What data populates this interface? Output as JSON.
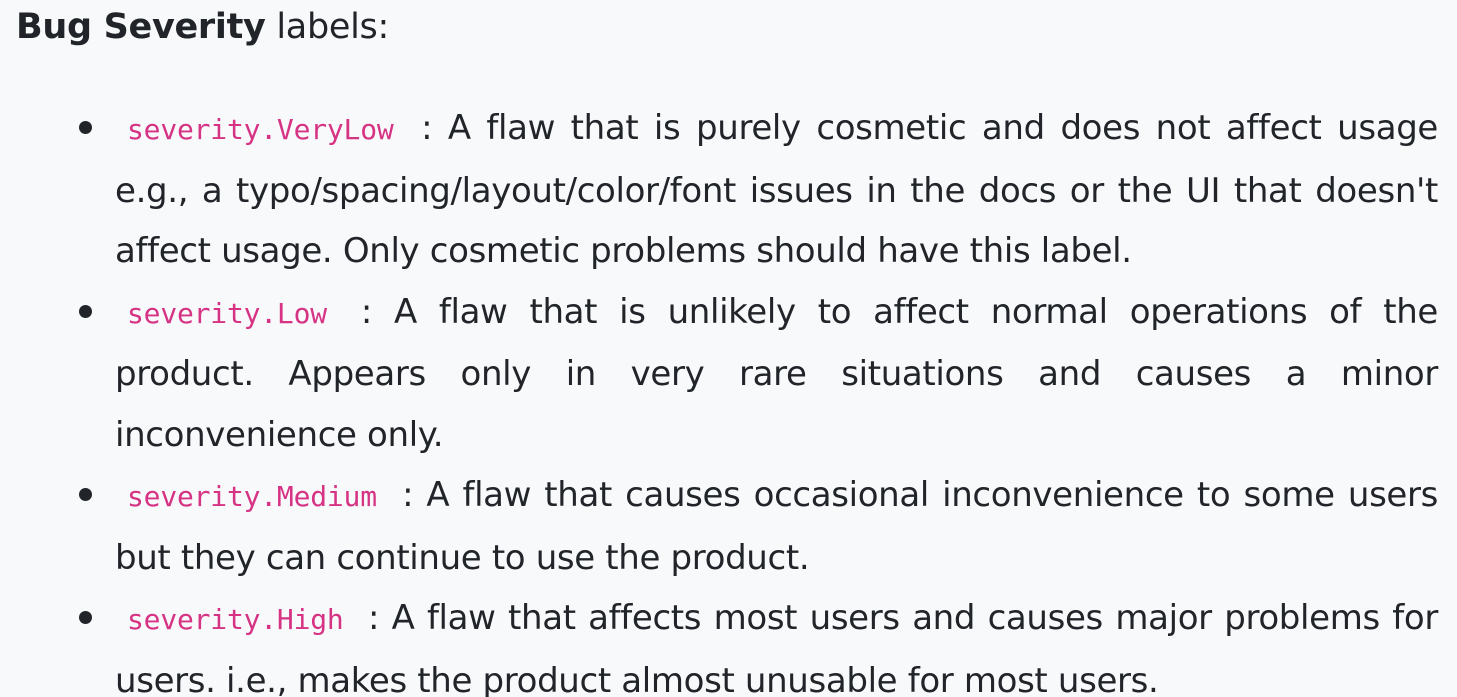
{
  "heading": {
    "bold": "Bug Severity",
    "rest": " labels:"
  },
  "items": [
    {
      "code": "severity.VeryLow",
      "text": ": A flaw that is purely cosmetic and does not affect usage e.g., a typo/spacing/layout/color/font issues in the docs or the UI that doesn't affect usage. Only cosmetic problems should have this label."
    },
    {
      "code": "severity.Low",
      "text": ": A flaw that is unlikely to affect normal operations of the product. Appears only in very rare situations and causes a minor inconvenience only."
    },
    {
      "code": "severity.Medium",
      "text": ": A flaw that causes occasional inconvenience to some users but they can continue to use the product."
    },
    {
      "code": "severity.High",
      "text": ": A flaw that affects most users and causes major problems for users. i.e., makes the product almost unusable for most users."
    }
  ],
  "colors": {
    "background": "#f8f9fb",
    "text": "#212529",
    "code": "#d63384"
  }
}
